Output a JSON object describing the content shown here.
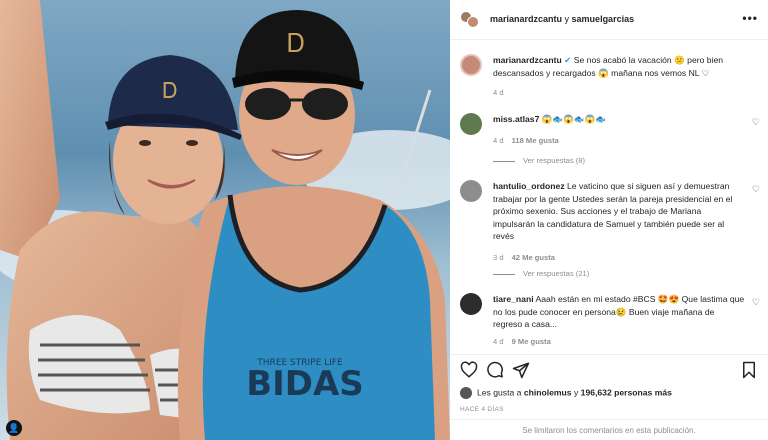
{
  "header": {
    "user1": "marianardzcantu",
    "connector": " y ",
    "user2": "samuelgarcias",
    "more_icon": "ellipsis-icon"
  },
  "caption": {
    "user": "marianardzcantu",
    "text": "Se nos acabó la vacación 😕 pero bien descansados y recargados 😱 mañana nos vemos NL ♡",
    "time": "4 d"
  },
  "comments": [
    {
      "user": "miss.atlas7",
      "text": "😱🐟😱🐟😱🐟",
      "time": "4 d",
      "likes": "118 Me gusta",
      "replies": "Ver respuestas (8)"
    },
    {
      "user": "hantulio_ordonez",
      "text": "Le vaticino que si siguen así y demuestran trabajar por la gente Ustedes serán la pareja presidencial en el próximo sexenio. Sus acciones y el trabajo de Mariana impulsarán la candidatura de Samuel y también puede ser al revés",
      "time": "3 d",
      "likes": "42 Me gusta",
      "replies": "Ver respuestas (21)"
    },
    {
      "user": "tiare_nani",
      "text": "Aaah están en mi estado #BCS 🤩😍 Que lastima que no los pude conocer en persona😢 Buen viaje mañana de regreso a casa...",
      "time": "4 d",
      "likes": "9 Me gusta"
    }
  ],
  "footer": {
    "likes_prefix": "Les gusta a ",
    "liker": "chinolemus",
    "likes_mid": " y ",
    "likes_count": "196,632 personas más",
    "ago": "HACE 4 DÍAS",
    "limited": "Se limitaron los comentarios en esta publicación."
  },
  "colors": {
    "sea": "#6f9bb8",
    "tank": "#2e8ec4",
    "link": "#262626",
    "muted": "#8e8e8e"
  }
}
